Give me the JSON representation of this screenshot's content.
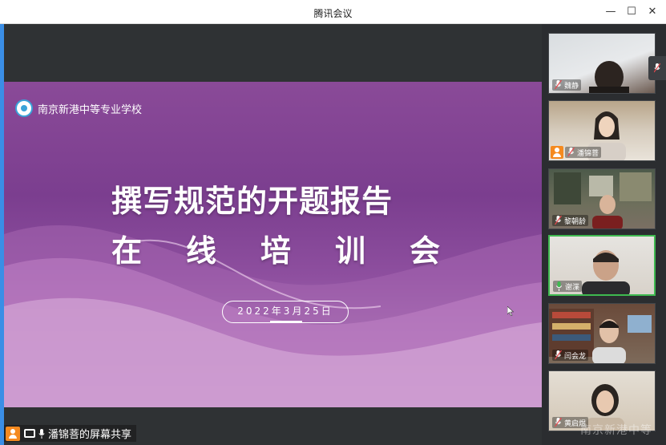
{
  "window": {
    "title": "腾讯会议",
    "minimize_glyph": "—",
    "maximize_glyph": "☐",
    "close_glyph": "✕"
  },
  "slide": {
    "school_name": "南京新港中等专业学校",
    "headline": "撰写规范的开题报告",
    "subline_chars": [
      "在",
      "线",
      "培",
      "训",
      "会"
    ],
    "date": "2022年3月25日"
  },
  "share_bar": {
    "text": "潘锦菩的屏幕共享"
  },
  "participants": [
    {
      "name": "魏静",
      "host": false,
      "active": false
    },
    {
      "name": "潘锦菩",
      "host": true,
      "active": false
    },
    {
      "name": "黎朝龄",
      "host": false,
      "active": false
    },
    {
      "name": "谢渫",
      "host": false,
      "active": true
    },
    {
      "name": "闫会龙",
      "host": false,
      "active": false
    },
    {
      "name": "黄启煜",
      "host": false,
      "active": false
    }
  ],
  "watermark": "南京新港中等",
  "colors": {
    "accent": "#3a8ee6",
    "active_speaker": "#3fb950",
    "host_badge": "#f58a1f"
  },
  "icons": {
    "mic": "mic-icon",
    "screen_share": "screen-share-icon",
    "host": "host-avatar-icon"
  }
}
